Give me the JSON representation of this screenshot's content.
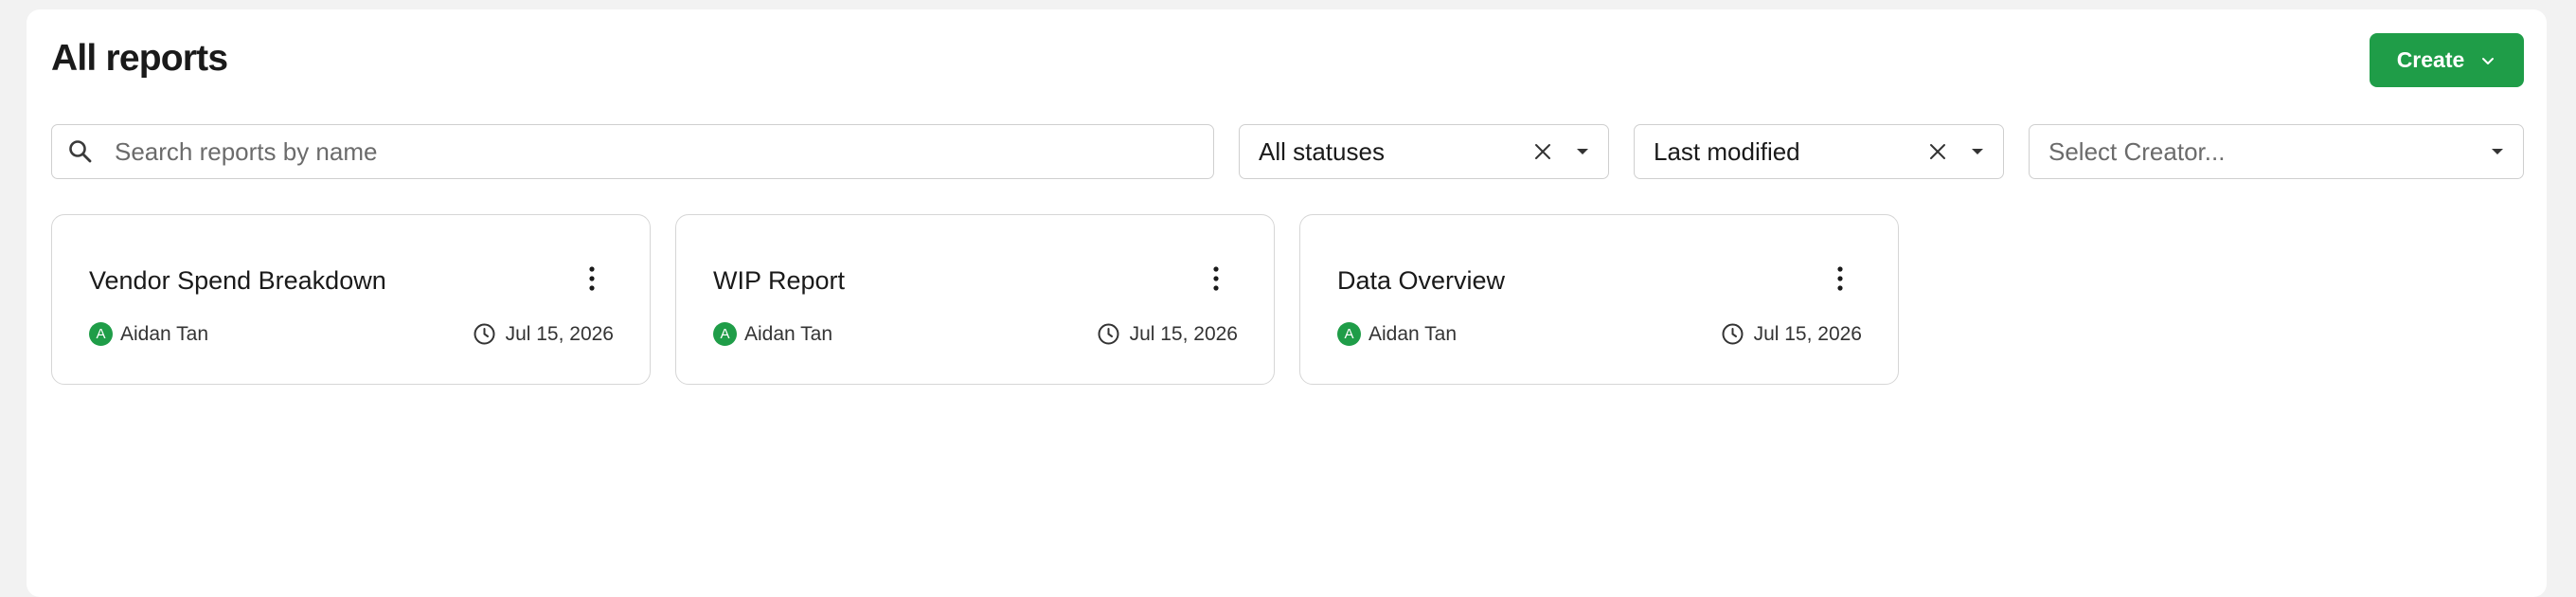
{
  "header": {
    "title": "All reports",
    "create_label": "Create"
  },
  "filters": {
    "search_placeholder": "Search reports by name",
    "status_value": "All statuses",
    "sort_value": "Last modified",
    "creator_placeholder": "Select Creator..."
  },
  "reports": [
    {
      "name": "Vendor Spend Breakdown",
      "author": "Aidan Tan",
      "author_initial": "A",
      "date": "Jul 15, 2026"
    },
    {
      "name": "WIP Report",
      "author": "Aidan Tan",
      "author_initial": "A",
      "date": "Jul 15, 2026"
    },
    {
      "name": "Data Overview",
      "author": "Aidan Tan",
      "author_initial": "A",
      "date": "Jul 15, 2026"
    }
  ],
  "colors": {
    "accent": "#1f9d48",
    "background": "#f2f2f2",
    "border": "#cfcfcf"
  },
  "icons": {
    "search": "search-icon",
    "clear": "close-icon",
    "dropdown": "caret-down-icon",
    "more": "vertical-dots-icon",
    "clock": "clock-icon",
    "chevron": "chevron-down-icon"
  }
}
